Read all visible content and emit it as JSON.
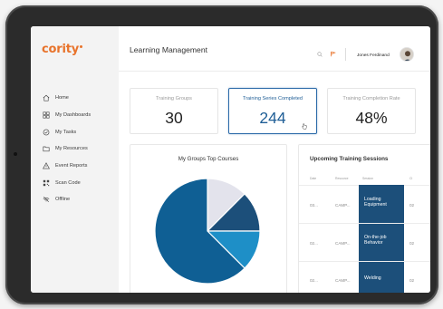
{
  "app": {
    "logo_text": "cority",
    "brand_color": "#e8732b"
  },
  "sidebar": {
    "items": [
      {
        "label": "Home",
        "icon": "home-icon"
      },
      {
        "label": "My Dashboards",
        "icon": "dashboard-icon"
      },
      {
        "label": "My Tasks",
        "icon": "tasks-icon"
      },
      {
        "label": "My Resources",
        "icon": "folder-icon"
      },
      {
        "label": "Event Reports",
        "icon": "warning-icon"
      },
      {
        "label": "Scan Code",
        "icon": "qr-code-icon"
      },
      {
        "label": "Offline",
        "icon": "offline-icon"
      }
    ]
  },
  "header": {
    "title": "Learning Management",
    "user_name": "Jones Ferdinand"
  },
  "kpis": [
    {
      "label": "Training Groups",
      "value": "30"
    },
    {
      "label": "Training Series Completed",
      "value": "244"
    },
    {
      "label": "Training Completion Rate",
      "value": "48%"
    }
  ],
  "pie_card": {
    "title": "My Groups Top Courses",
    "slice_fractions": [
      0.125,
      0.125,
      0.125,
      0.625
    ],
    "slice_colors": [
      "#e3e3ec",
      "#1c4f7a",
      "#1e8fc7",
      "#0f5f94"
    ]
  },
  "sessions": {
    "title": "Upcoming Training Sessions",
    "headers": {
      "date": "Date",
      "resource": "Resource",
      "session": "Session",
      "extra": "Cl"
    },
    "rows": [
      {
        "date": "03...",
        "resource": "CAMP...",
        "session_line1": "Loading",
        "session_line2": "Equipment",
        "extra": "02"
      },
      {
        "date": "02...",
        "resource": "CAMP...",
        "session_line1": "On-the-job",
        "session_line2": "Behavior",
        "extra": "02"
      },
      {
        "date": "02...",
        "resource": "CAMP...",
        "session_line1": "Welding",
        "session_line2": "",
        "extra": "02"
      }
    ]
  }
}
